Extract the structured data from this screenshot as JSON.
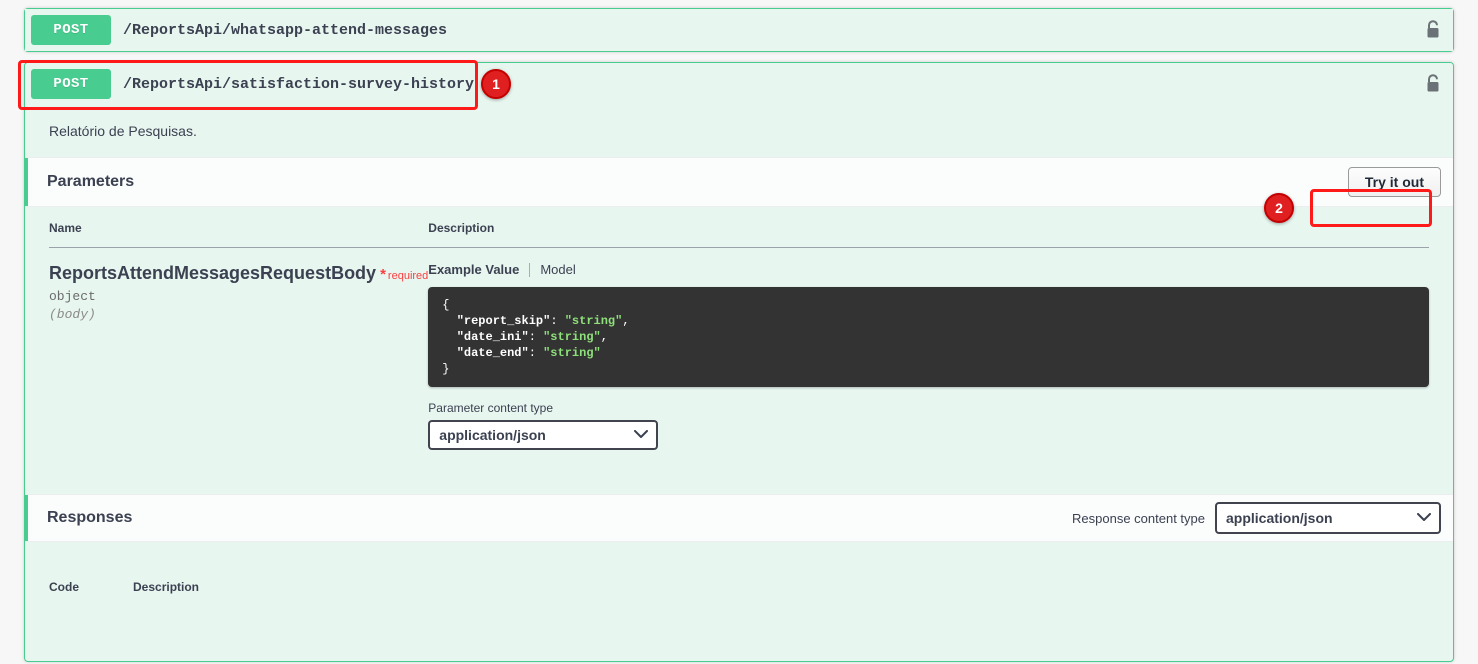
{
  "operations": [
    {
      "verb": "POST",
      "path": "/ReportsApi/whatsapp-attend-messages",
      "lock_icon": "unlocked-padlock-icon"
    },
    {
      "verb": "POST",
      "path": "/ReportsApi/satisfaction-survey-history",
      "lock_icon": "unlocked-padlock-icon",
      "description": "Relatório de Pesquisas."
    }
  ],
  "parameters_section": {
    "title": "Parameters",
    "try_it_out_label": "Try it out",
    "columns": {
      "name": "Name",
      "description": "Description"
    },
    "row": {
      "name": "ReportsAttendMessagesRequestBody",
      "required_star": "*",
      "required_label": "required",
      "type": "object",
      "location": "(body)",
      "example_tab": "Example Value",
      "model_tab": "Model",
      "example_json": {
        "line1_open": "{",
        "line2_key": "\"report_skip\"",
        "line2_val": "\"string\"",
        "line3_key": "\"date_ini\"",
        "line3_val": "\"string\"",
        "line4_key": "\"date_end\"",
        "line4_val": "\"string\"",
        "line5_close": "}"
      },
      "content_type_label": "Parameter content type",
      "content_type_value": "application/json"
    }
  },
  "responses_section": {
    "title": "Responses",
    "content_type_label": "Response content type",
    "content_type_value": "application/json",
    "columns": {
      "code": "Code",
      "description": "Description"
    }
  },
  "annotations": [
    {
      "number": "1",
      "target": "satisfaction-survey-history operation row"
    },
    {
      "number": "2",
      "target": "Try it out button"
    }
  ],
  "colors": {
    "post_green": "#49cc90",
    "panel_bg": "#e8f6f0",
    "strip_bg": "#fbfcfc",
    "code_bg": "#333333",
    "code_string": "#8ee07a",
    "required_red": "#f93e3e",
    "annotation_red": "#ff1a1a",
    "page_bg": "#f7f7f7"
  }
}
